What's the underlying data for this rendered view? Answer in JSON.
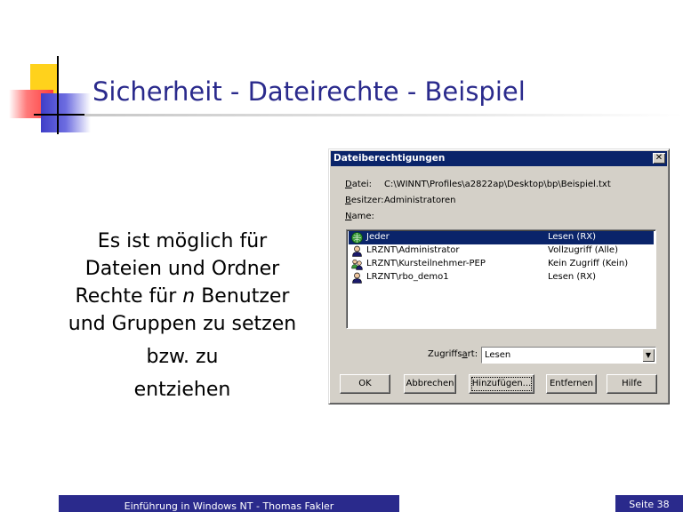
{
  "slide": {
    "title": "Sicherheit - Dateirechte - Beispiel",
    "body": {
      "line1": "Es ist möglich für",
      "line2": "Dateien und Ordner",
      "line3_pre": "Rechte für ",
      "line3_em": "n",
      "line3_post": " Benutzer",
      "line4": "und Gruppen zu setzen",
      "line5": "bzw. zu",
      "line6": "entziehen"
    },
    "footer_left": "Einführung in Windows NT - Thomas Fakler",
    "footer_right": "Seite 38",
    "colors": {
      "title": "#2a2a8c",
      "footer_bg": "#2a2a8c",
      "logo_yellow": "#ffd21c",
      "logo_red": "#ff3c3c",
      "logo_blue": "#3e3ec8"
    }
  },
  "dialog": {
    "title": "Dateiberechtigungen",
    "close_icon": "close-icon",
    "file_label_u": "D",
    "file_label_rest": "atei:",
    "file_value": "C:\\WINNT\\Profiles\\a2822ap\\Desktop\\bp\\Beispiel.txt",
    "owner_label_u": "B",
    "owner_label_rest": "esitzer:",
    "owner_value": "Administratoren",
    "name_label_u": "N",
    "name_label_rest": "ame:",
    "entries": [
      {
        "name": "Jeder",
        "permission": "Lesen (RX)",
        "icon": "group-icon",
        "selected": true
      },
      {
        "name": "LRZNT\\Administrator",
        "permission": "Vollzugriff (Alle)",
        "icon": "user-icon",
        "selected": false
      },
      {
        "name": "LRZNT\\Kursteilnehmer-PEP",
        "permission": "Kein Zugriff (Kein)",
        "icon": "group-icon",
        "selected": false
      },
      {
        "name": "LRZNT\\rbo_demo1",
        "permission": "Lesen (RX)",
        "icon": "user-icon",
        "selected": false
      }
    ],
    "access_label_pre": "Zugriffs",
    "access_label_u": "a",
    "access_label_post": "rt:",
    "access_value": "Lesen",
    "buttons": {
      "ok": "OK",
      "cancel": "Abbrechen",
      "add": "Hinzufügen...",
      "remove": "Entfernen",
      "help": "Hilfe"
    },
    "colors": {
      "face": "#d4d0c8",
      "titlebar": "#0a246a",
      "selection": "#0a246a"
    }
  }
}
